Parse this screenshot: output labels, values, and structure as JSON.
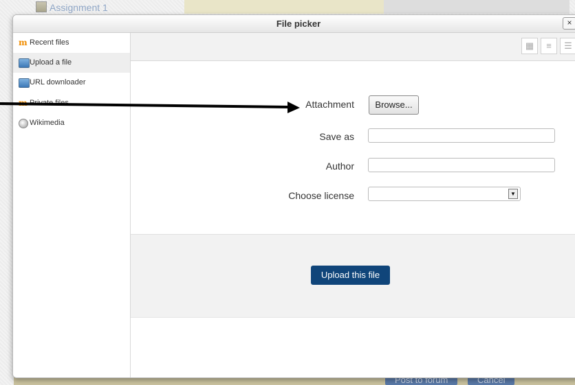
{
  "background": {
    "assignment_link": "Assignment 1",
    "post_button": "Post to forum",
    "cancel_button": "Cancel"
  },
  "dialog": {
    "title": "File picker",
    "close_symbol": "×"
  },
  "sidebar": {
    "items": [
      {
        "label": "Recent files",
        "icon": "moodle-icon",
        "active": false
      },
      {
        "label": "Upload a file",
        "icon": "upload-icon",
        "active": true
      },
      {
        "label": "URL downloader",
        "icon": "upload-icon",
        "active": false
      },
      {
        "label": "Private files",
        "icon": "moodle-icon",
        "active": false
      },
      {
        "label": "Wikimedia",
        "icon": "wikimedia-icon",
        "active": false
      }
    ]
  },
  "toolbar": {
    "views": [
      "icons-view-icon",
      "list-view-icon",
      "tree-view-icon"
    ]
  },
  "form": {
    "attachment_label": "Attachment",
    "browse_label": "Browse...",
    "save_as_label": "Save as",
    "save_as_value": "",
    "author_label": "Author",
    "author_value": "",
    "license_label": "Choose license",
    "license_value": "",
    "upload_button": "Upload this file"
  },
  "colors": {
    "upload_button": "#10457a",
    "moodle_orange": "#f08c00",
    "annotation_arrow": "#000000"
  }
}
